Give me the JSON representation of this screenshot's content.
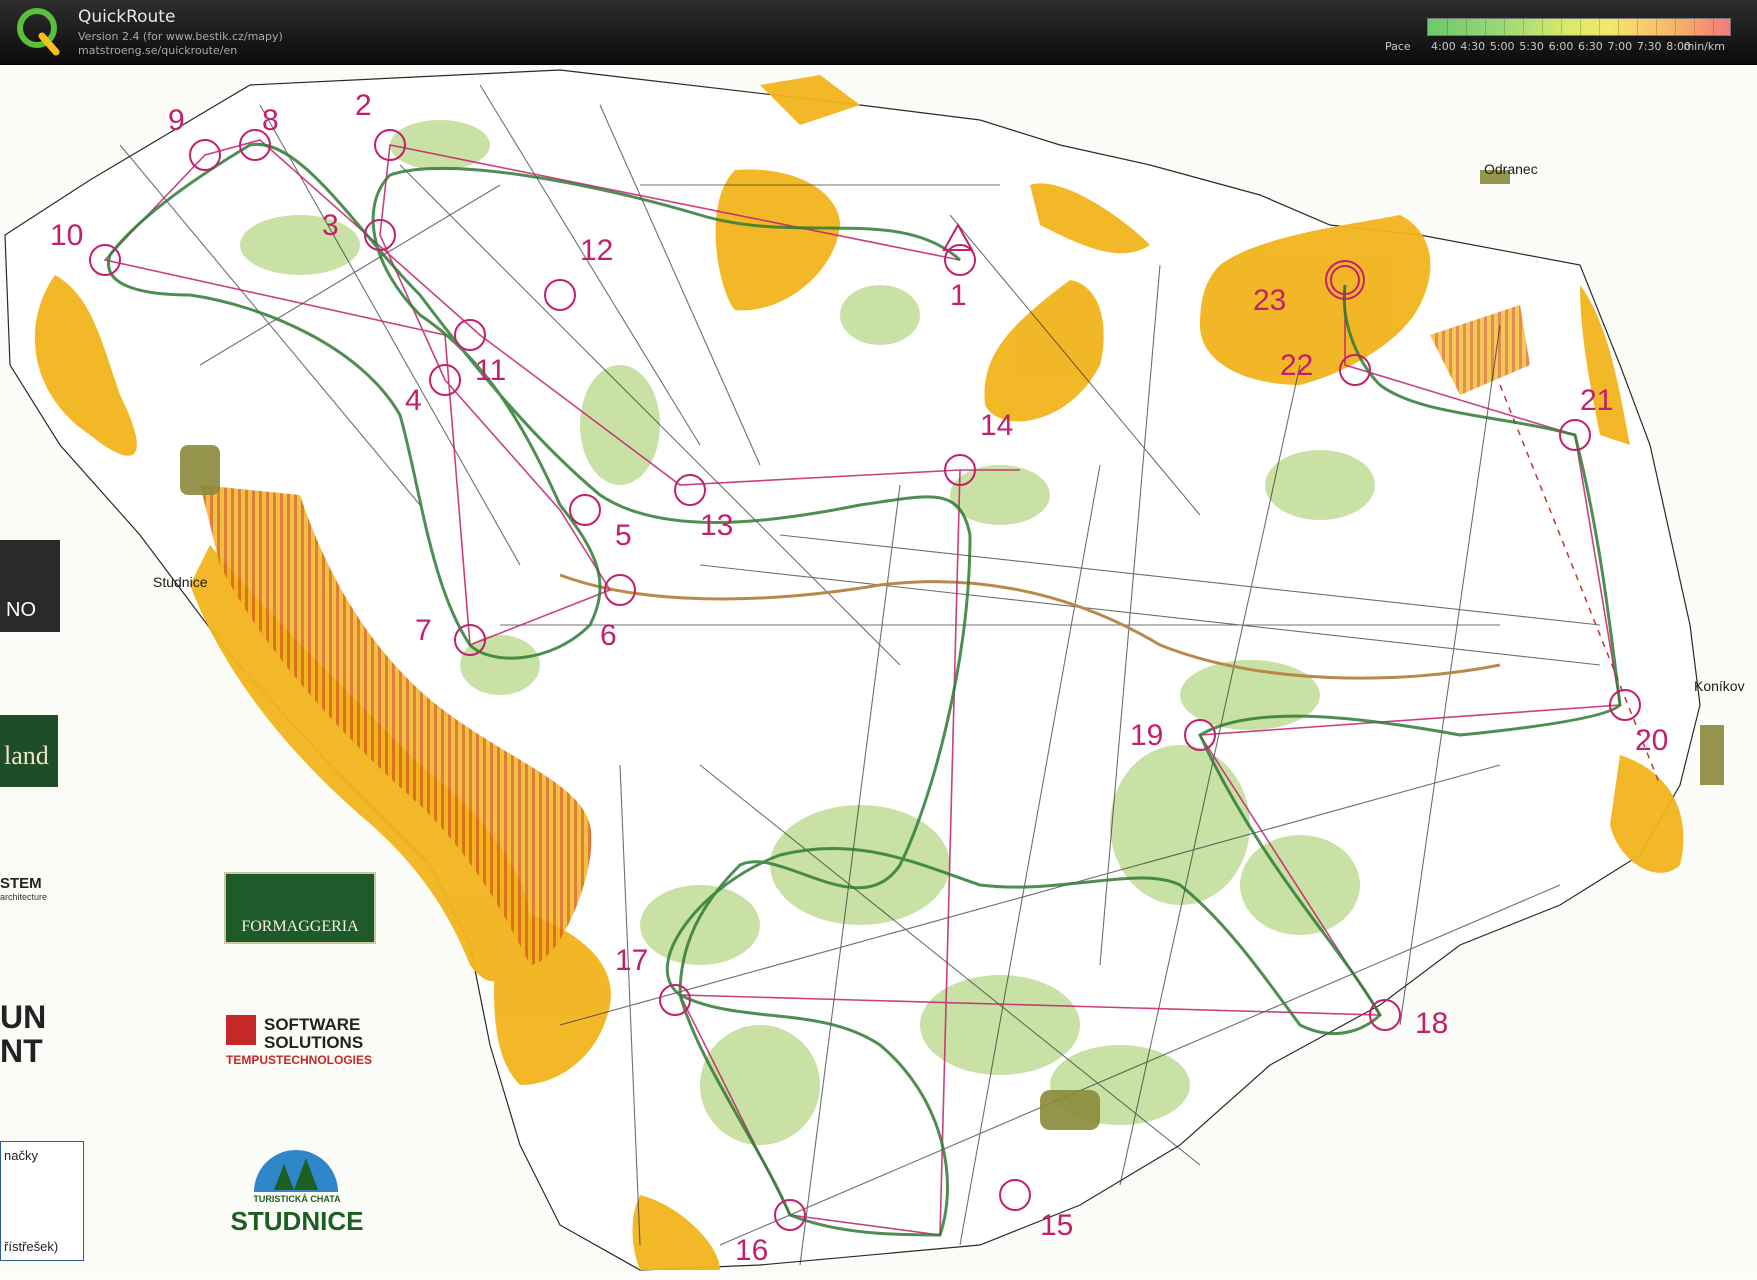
{
  "app": {
    "title": "QuickRoute",
    "version": "Version 2.4  (for www.bestik.cz/mapy)",
    "url": "matstroeng.se/quickroute/en"
  },
  "pace_legend": {
    "label": "Pace",
    "ticks": [
      "4:00",
      "4:30",
      "5:00",
      "5:30",
      "6:00",
      "6:30",
      "7:00",
      "7:30",
      "8:00"
    ],
    "unit": "min/km"
  },
  "map": {
    "colors": {
      "open_land": "#f2b41c",
      "forest_green": "#9cc95a",
      "course": "#c21f6c",
      "route": "#2f7a35",
      "rough_open": "#d9661a"
    },
    "place_names": [
      "Odranec",
      "Studnice",
      "Koníkov"
    ],
    "controls": [
      "1",
      "2",
      "3",
      "4",
      "5",
      "6",
      "7",
      "8",
      "9",
      "10",
      "11",
      "12",
      "13",
      "14",
      "15",
      "16",
      "17",
      "18",
      "19",
      "20",
      "21",
      "22",
      "23"
    ],
    "sponsors": {
      "formaggeria": "FORMAGGERIA",
      "software_line1": "SOFTWARE",
      "software_line2": "SOLUTIONS",
      "software_line3": "TEMPUSTECHNOLOGIES",
      "studnice_small": "TURISTICKÁ CHATA",
      "studnice_big": "STUDNICE",
      "edge_no": "NO",
      "edge_land": "land",
      "edge_stem": "STEM",
      "edge_stem2": "architecture",
      "edge_un": "UN",
      "edge_nt": "NT",
      "edge_legend1": "načky",
      "edge_legend2": "řístřešek)"
    }
  }
}
